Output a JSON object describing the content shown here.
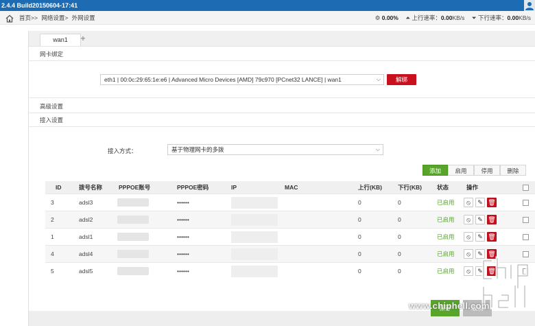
{
  "topbar": {
    "title": "2.4.4 Build20150604-17:41"
  },
  "breadcrumb": [
    "首页>>",
    "网络设置>",
    "外网设置"
  ],
  "stats": {
    "cpu": "0.00%",
    "up_label": "上行速率：",
    "up_value": "0.00",
    "up_unit": "KB/s",
    "down_label": "下行速率：",
    "down_value": "0.00",
    "down_unit": "KB/s"
  },
  "tabs": [
    {
      "label": "wan1"
    }
  ],
  "sections": {
    "nic": "网卡绑定",
    "advanced": "高级设置",
    "access": "接入设置"
  },
  "nic": {
    "value": "eth1 | 00:0c:29:65:1e:e6 | Advanced Micro Devices [AMD] 79c970 [PCnet32 LANCE] | wan1",
    "unbind_label": "解绑"
  },
  "access": {
    "mode_label": "接入方式：",
    "mode_value": "基于物理网卡的多拨"
  },
  "actions": {
    "add": "添加",
    "enable": "启用",
    "disable": "停用",
    "delete": "删除"
  },
  "table": {
    "headers": {
      "id": "ID",
      "name": "拨号名称",
      "account": "PPPOE账号",
      "password": "PPPOE密码",
      "ip": "IP",
      "mac": "MAC",
      "up": "上行(KB)",
      "down": "下行(KB)",
      "status": "状态",
      "ops": "操作"
    },
    "rows": [
      {
        "id": "3",
        "name": "adsl3",
        "password": "••••••",
        "up": "0",
        "down": "0",
        "status": "已启用"
      },
      {
        "id": "2",
        "name": "adsl2",
        "password": "••••••",
        "up": "0",
        "down": "0",
        "status": "已启用"
      },
      {
        "id": "1",
        "name": "adsl1",
        "password": "••••••",
        "up": "0",
        "down": "0",
        "status": "已启用"
      },
      {
        "id": "4",
        "name": "adsl4",
        "password": "••••••",
        "up": "0",
        "down": "0",
        "status": "已启用"
      },
      {
        "id": "5",
        "name": "adsl5",
        "password": "••••••",
        "up": "0",
        "down": "0",
        "status": "已启用"
      }
    ]
  },
  "footer": {
    "save": "保存",
    "cancel": "取消"
  },
  "watermark": {
    "text": "www.chiphell.com",
    "logo_text": "chiphell"
  },
  "icons": {
    "home": "home-icon",
    "user": "user-icon",
    "cpu": "gear-icon",
    "upload": "upload-icon",
    "download": "download-icon",
    "ban": "ban-icon",
    "edit": "pencil-icon",
    "trash": "trash-icon"
  },
  "colors": {
    "topbar": "#1d6bb3",
    "danger": "#c9101f",
    "success": "#58a52a",
    "status_enabled": "#5aa630"
  }
}
